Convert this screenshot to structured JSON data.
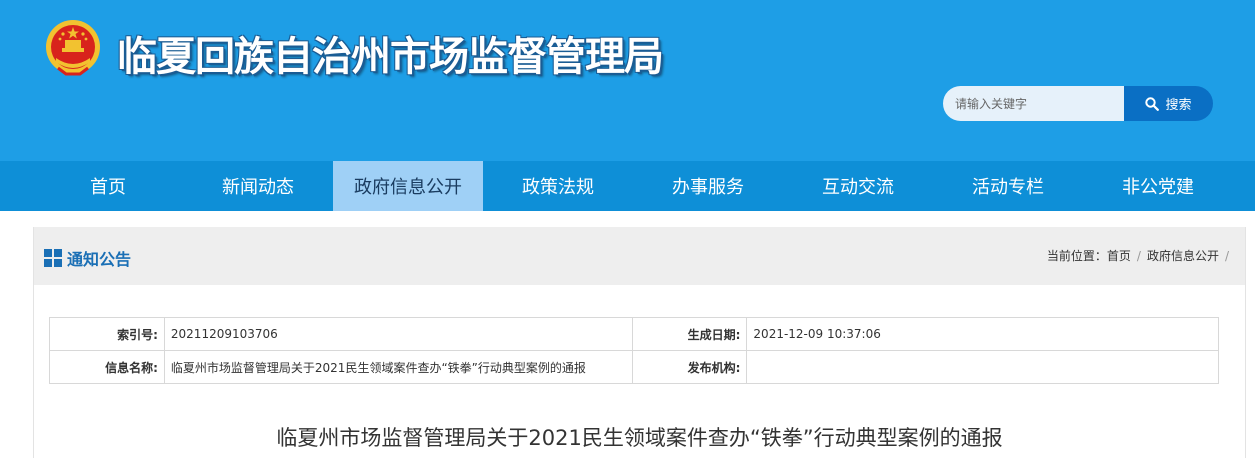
{
  "header": {
    "site_title": "临夏回族自治州市场监督管理局",
    "search_placeholder": "请输入关键字",
    "search_button_label": "搜索",
    "colors": {
      "header_bg": "#1e9ee6",
      "nav_bg": "#0e8fd7",
      "nav_active_bg": "#9fd0f6",
      "search_button_bg": "#0a6fc4"
    }
  },
  "nav": {
    "items": [
      {
        "label": "首页"
      },
      {
        "label": "新闻动态"
      },
      {
        "label": "政府信息公开",
        "active": true
      },
      {
        "label": "政策法规"
      },
      {
        "label": "办事服务"
      },
      {
        "label": "互动交流"
      },
      {
        "label": "活动专栏"
      },
      {
        "label": "非公党建"
      }
    ]
  },
  "panel": {
    "title": "通知公告",
    "title_icon": "grid-icon",
    "breadcrumb": {
      "prefix": "当前位置：",
      "items": [
        "首页",
        "政府信息公开"
      ],
      "separator": "/"
    }
  },
  "info": {
    "index_label": "索引号:",
    "index_value": "20211209103706",
    "date_label": "生成日期:",
    "date_value": "2021-12-09 10:37:06",
    "name_label": "信息名称:",
    "name_value": "临夏州市场监督管理局关于2021民生领域案件查办“铁拳”行动典型案例的通报",
    "publisher_label": "发布机构:",
    "publisher_value": ""
  },
  "document": {
    "title": "临夏州市场监督管理局关于2021民生领域案件查办“铁拳”行动典型案例的通报"
  }
}
